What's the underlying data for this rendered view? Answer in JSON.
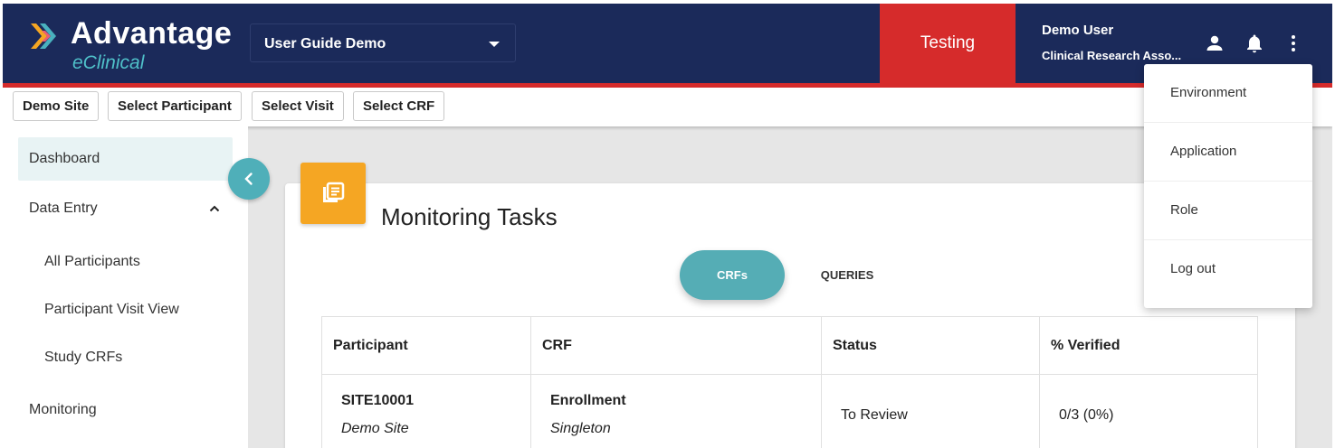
{
  "header": {
    "brand_title": "Advantage",
    "brand_subtitle": "eClinical",
    "study_name": "User Guide Demo",
    "environment": "Testing",
    "user_name": "Demo User",
    "user_role": "Clinical Research Asso...",
    "colors": {
      "navy": "#1b2a5a",
      "red": "#d62b2b",
      "teal": "#4fc0c9"
    }
  },
  "toolbar": {
    "site": "Demo Site",
    "participant": "Select Participant",
    "visit": "Select Visit",
    "crf": "Select CRF"
  },
  "sidebar": {
    "dashboard": "Dashboard",
    "data_entry": "Data Entry",
    "sub_items": [
      "All Participants",
      "Participant Visit View",
      "Study CRFs"
    ],
    "monitoring": "Monitoring"
  },
  "main": {
    "title": "Monitoring Tasks",
    "tabs": [
      "CRFs",
      "QUERIES"
    ],
    "active_tab": "CRFs",
    "columns": [
      "Participant",
      "CRF",
      "Status",
      "% Verified"
    ],
    "rows": [
      {
        "participant": "SITE10001",
        "site": "Demo Site",
        "crf": "Enrollment",
        "crf_type": "Singleton",
        "status": "To Review",
        "verified": "0/3 (0%)"
      }
    ]
  },
  "user_menu": {
    "items": [
      "Environment",
      "Application",
      "Role",
      "Log out"
    ]
  },
  "icons": {
    "user": "person-icon",
    "notifications": "bell-icon",
    "more": "more-vert-icon",
    "collapse": "chevron-left-icon",
    "card": "document-list-icon"
  }
}
